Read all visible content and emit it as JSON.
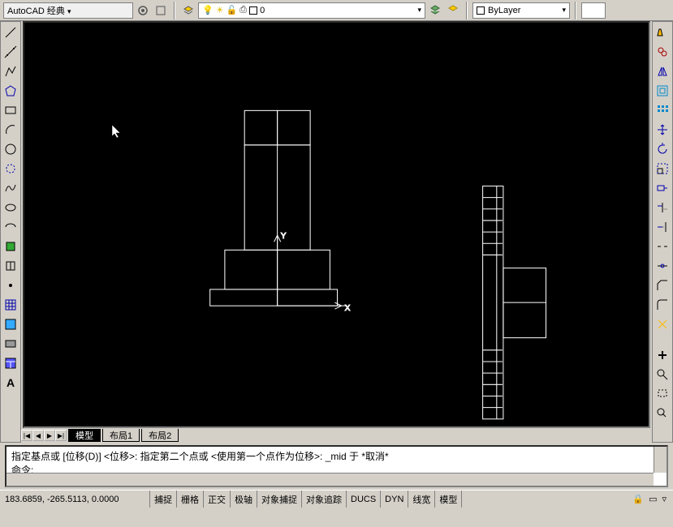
{
  "topbar": {
    "workspace_label": "AutoCAD 经典",
    "layer_value": "0",
    "bylayer_label": "ByLayer"
  },
  "tabs": {
    "nav": [
      "|◀",
      "◀",
      "▶",
      "▶|"
    ],
    "model": "模型",
    "layout1": "布局1",
    "layout2": "布局2"
  },
  "command": {
    "line1": "指定基点或 [位移(D)] <位移>:  指定第二个点或 <使用第一个点作为位移>: _mid 于 *取消*",
    "line2": "命令:"
  },
  "status": {
    "coords": "183.6859, -265.5113, 0.0000",
    "buttons": [
      "捕捉",
      "栅格",
      "正交",
      "极轴",
      "对象捕捉",
      "对象追踪",
      "DUCS",
      "DYN",
      "线宽",
      "模型"
    ]
  },
  "left_tools": [
    "line",
    "xline",
    "pline",
    "polygon",
    "rect",
    "arc",
    "circle",
    "revcloud",
    "spline",
    "ellipse",
    "ellipse-arc",
    "block",
    "point",
    "hatch",
    "gradient",
    "region",
    "table",
    "text"
  ],
  "right_tools": [
    "distance",
    "area",
    "mirror",
    "offset",
    "array",
    "move",
    "rotate",
    "scale",
    "stretch",
    "trim",
    "extend",
    "break",
    "chamfer",
    "fillet",
    "explode"
  ],
  "right_tools2": [
    "pan",
    "zoom",
    "zoom-win",
    "zoom-prev",
    "orbit"
  ]
}
